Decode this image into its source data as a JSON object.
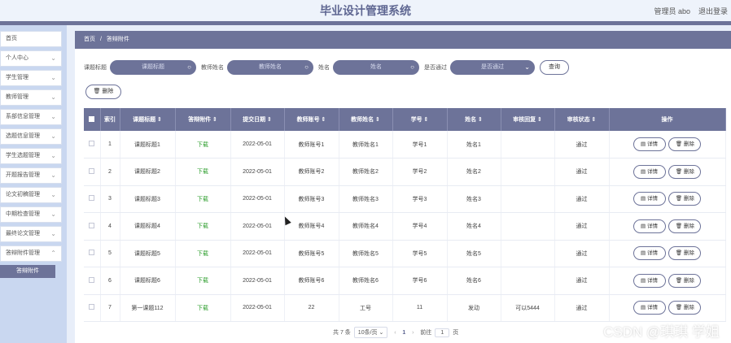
{
  "header": {
    "title": "毕业设计管理系统",
    "user_label": "管理员 abo",
    "logout_label": "退出登录"
  },
  "sidebar": {
    "items": [
      {
        "label": "首页",
        "has_chevron": false
      },
      {
        "label": "个人中心",
        "has_chevron": true
      },
      {
        "label": "学生管理",
        "has_chevron": true
      },
      {
        "label": "教师管理",
        "has_chevron": true
      },
      {
        "label": "系部信息管理",
        "has_chevron": true
      },
      {
        "label": "选题信息管理",
        "has_chevron": true
      },
      {
        "label": "学生选题管理",
        "has_chevron": true
      },
      {
        "label": "开题报告管理",
        "has_chevron": true
      },
      {
        "label": "论文初稿管理",
        "has_chevron": true
      },
      {
        "label": "中期检查管理",
        "has_chevron": true
      },
      {
        "label": "最终论文管理",
        "has_chevron": true
      },
      {
        "label": "答辩附件管理",
        "has_chevron": true
      }
    ],
    "active_sub": "答辩附件"
  },
  "breadcrumb": {
    "home": "首页",
    "sep": "/",
    "current": "答辩附件"
  },
  "filters": {
    "f1_label": "课题标题",
    "f1_placeholder": "课题标题",
    "f2_label": "教师姓名",
    "f2_placeholder": "教师姓名",
    "f3_label": "姓名",
    "f3_placeholder": "姓名",
    "f4_label": "是否通过",
    "f4_placeholder": "是否通过",
    "query_label": "查询"
  },
  "toolbar": {
    "delete_label": "删除"
  },
  "table": {
    "headers": [
      "索引",
      "课题标题 ⇕",
      "答辩附件 ⇕",
      "提交日期 ⇕",
      "教师账号 ⇕",
      "教师姓名 ⇕",
      "学号 ⇕",
      "姓名 ⇕",
      "审核回复 ⇕",
      "审核状态 ⇕",
      "操作"
    ],
    "rows": [
      [
        "1",
        "课题标题1",
        "下载",
        "2022-05-01",
        "教师账号1",
        "教师姓名1",
        "学号1",
        "姓名1",
        "",
        "通过"
      ],
      [
        "2",
        "课题标题2",
        "下载",
        "2022-05-01",
        "教师账号2",
        "教师姓名2",
        "学号2",
        "姓名2",
        "",
        "通过"
      ],
      [
        "3",
        "课题标题3",
        "下载",
        "2022-05-01",
        "教师账号3",
        "教师姓名3",
        "学号3",
        "姓名3",
        "",
        "通过"
      ],
      [
        "4",
        "课题标题4",
        "下载",
        "2022-05-01",
        "教师账号4",
        "教师姓名4",
        "学号4",
        "姓名4",
        "",
        "通过"
      ],
      [
        "5",
        "课题标题5",
        "下载",
        "2022-05-01",
        "教师账号5",
        "教师姓名5",
        "学号5",
        "姓名5",
        "",
        "通过"
      ],
      [
        "6",
        "课题标题6",
        "下载",
        "2022-05-01",
        "教师账号6",
        "教师姓名6",
        "学号6",
        "姓名6",
        "",
        "通过"
      ],
      [
        "7",
        "第一课题112",
        "下载",
        "2022-05-01",
        "22",
        "工号",
        "11",
        "发动",
        "可以5444",
        "通过"
      ]
    ],
    "detail_label": "详情",
    "row_delete_label": "删除"
  },
  "pager": {
    "total": "共 7 条",
    "page_size": "10条/页",
    "current_page": "1",
    "goto_label": "前往",
    "goto_value": "1",
    "page_unit": "页"
  },
  "watermark": "CSDN @琪琪 学姐",
  "colors": {
    "accent": "#6d7399",
    "sidebar_bg": "#c9d7f0",
    "download": "#2e9e2e"
  }
}
